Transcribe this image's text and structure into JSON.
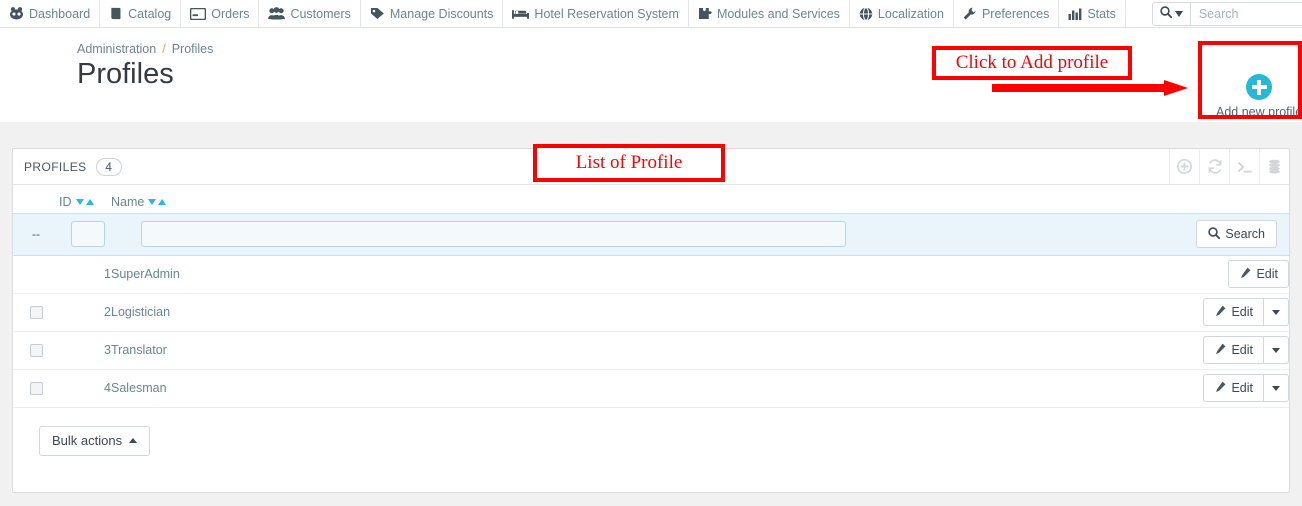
{
  "topnav": {
    "items": [
      {
        "label": "Dashboard",
        "icon": "dashboard-icon"
      },
      {
        "label": "Catalog",
        "icon": "book-icon"
      },
      {
        "label": "Orders",
        "icon": "card-icon"
      },
      {
        "label": "Customers",
        "icon": "people-icon"
      },
      {
        "label": "Manage Discounts",
        "icon": "tag-icon"
      },
      {
        "label": "Hotel Reservation System",
        "icon": "bed-icon"
      },
      {
        "label": "Modules and Services",
        "icon": "puzzle-icon"
      },
      {
        "label": "Localization",
        "icon": "globe-icon"
      },
      {
        "label": "Preferences",
        "icon": "wrench-icon"
      },
      {
        "label": "Stats",
        "icon": "bar-chart-icon"
      }
    ],
    "search": {
      "placeholder": "Search",
      "value": "",
      "dropdown_icon": "search-icon"
    },
    "more_label": "•••"
  },
  "header": {
    "breadcrumb": {
      "parent": "Administration",
      "separator": "/",
      "current": "Profiles"
    },
    "title": "Profiles",
    "add_new": {
      "label": "Add new profile",
      "icon": "plus-circle-icon"
    }
  },
  "panel": {
    "title": "PROFILES",
    "count": "4",
    "tools": [
      {
        "name": "add-icon",
        "glyph": "plus-circle"
      },
      {
        "name": "refresh-icon",
        "glyph": "refresh"
      },
      {
        "name": "console-icon",
        "glyph": "terminal"
      },
      {
        "name": "database-icon",
        "glyph": "database"
      }
    ]
  },
  "table": {
    "columns": {
      "id": "ID",
      "name": "Name"
    },
    "filter": {
      "dashes": "--",
      "id_value": "",
      "name_value": "",
      "search_label": "Search",
      "search_icon": "search-icon"
    },
    "rows": [
      {
        "id": "1",
        "name": "SuperAdmin",
        "has_checkbox": false,
        "has_dropdown": false,
        "edit_label": "Edit"
      },
      {
        "id": "2",
        "name": "Logistician",
        "has_checkbox": true,
        "has_dropdown": true,
        "edit_label": "Edit"
      },
      {
        "id": "3",
        "name": "Translator",
        "has_checkbox": true,
        "has_dropdown": true,
        "edit_label": "Edit"
      },
      {
        "id": "4",
        "name": "Salesman",
        "has_checkbox": true,
        "has_dropdown": true,
        "edit_label": "Edit"
      }
    ],
    "bulk_actions": {
      "label": "Bulk actions",
      "caret": "up"
    }
  },
  "annotations": {
    "click_to_add": "Click to Add profile",
    "list_of_profile": "List of Profile",
    "color": "#fe0000"
  },
  "colors": {
    "accent_cyan": "#25b9d7",
    "sort_blue": "#29b6e8",
    "body_bg": "#f1f1f1",
    "text_muted": "#6c868e",
    "filter_bg": "#eaf4fb"
  }
}
